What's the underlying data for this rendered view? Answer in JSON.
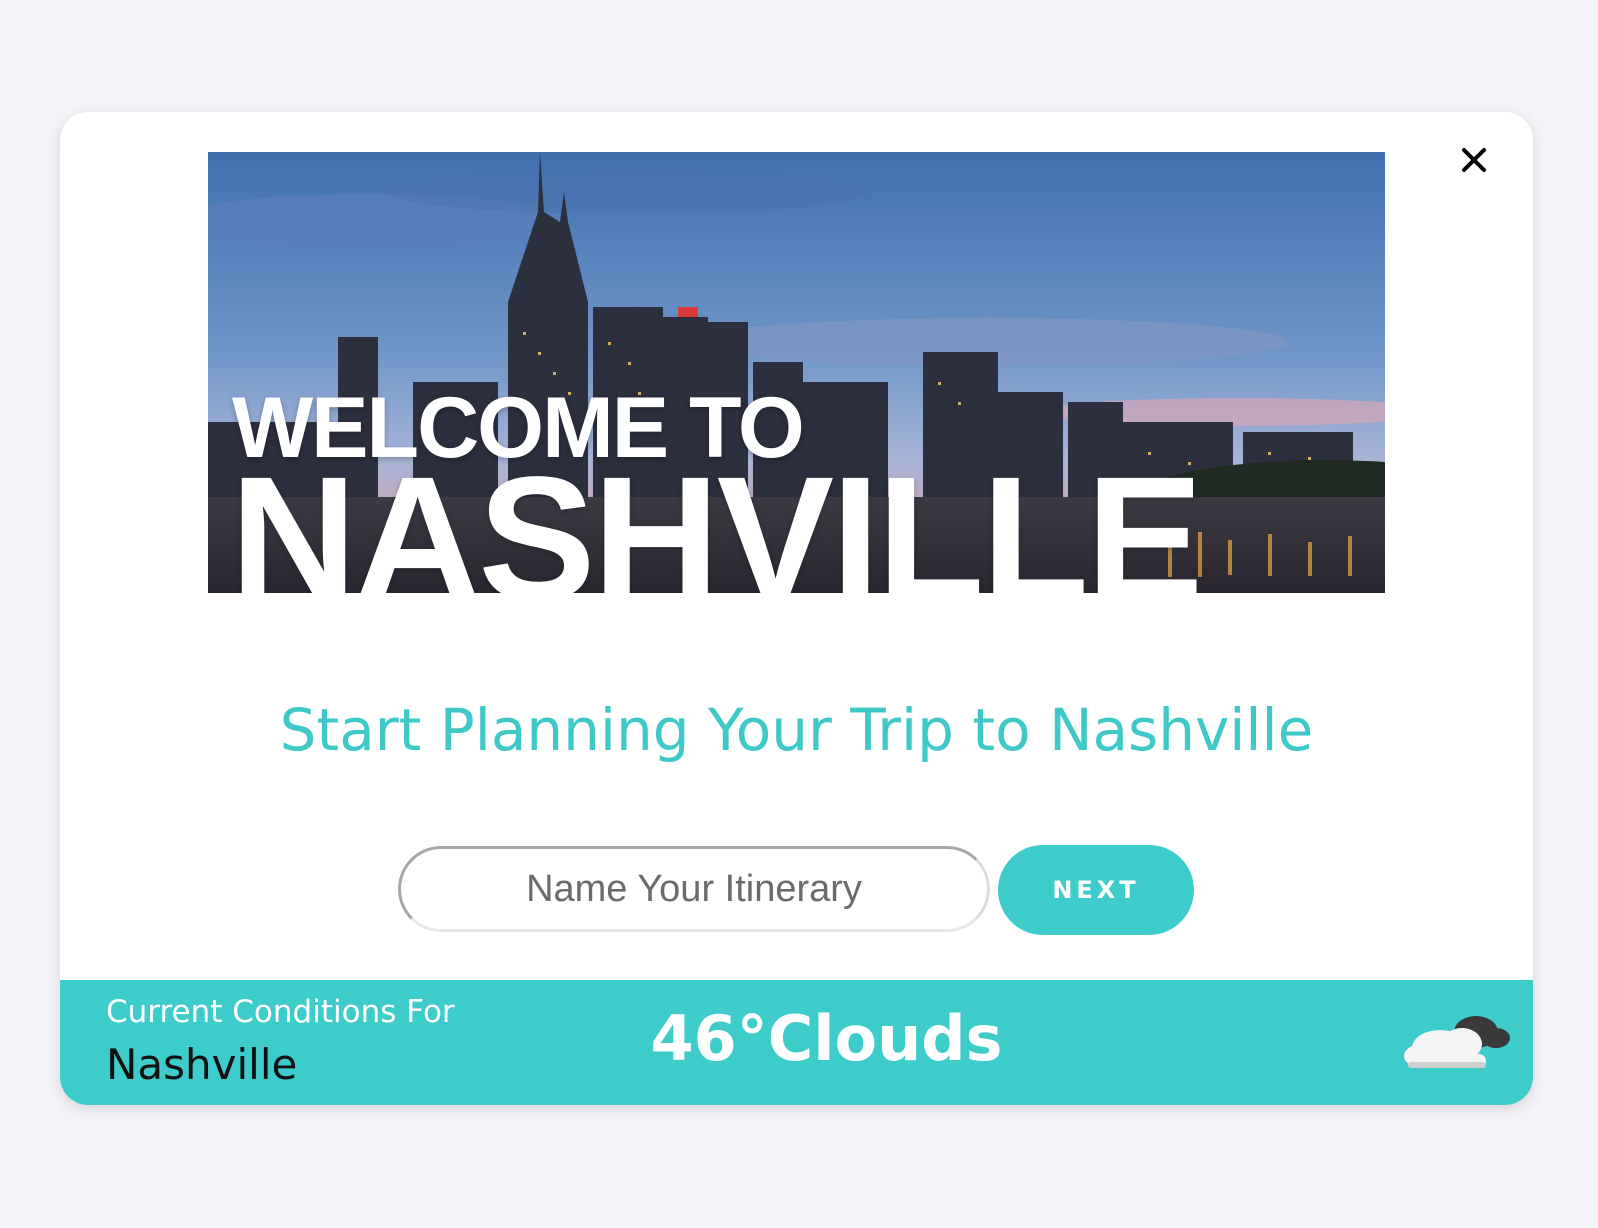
{
  "modal": {
    "close_label": "×"
  },
  "hero": {
    "line1": "WELCOME TO",
    "line2": "NASHVILLE"
  },
  "headline": "Start Planning Your Trip to Nashville",
  "itinerary": {
    "placeholder": "Name Your Itinerary",
    "value": ""
  },
  "next_label": "NEXT",
  "weather": {
    "label": "Current Conditions For",
    "city": "Nashville",
    "temperature": "46°",
    "condition": "Clouds",
    "icon": "cloud-icon"
  },
  "colors": {
    "accent": "#3ecccb",
    "headline": "#3ec8c8",
    "page_bg": "#f4f4f8"
  }
}
